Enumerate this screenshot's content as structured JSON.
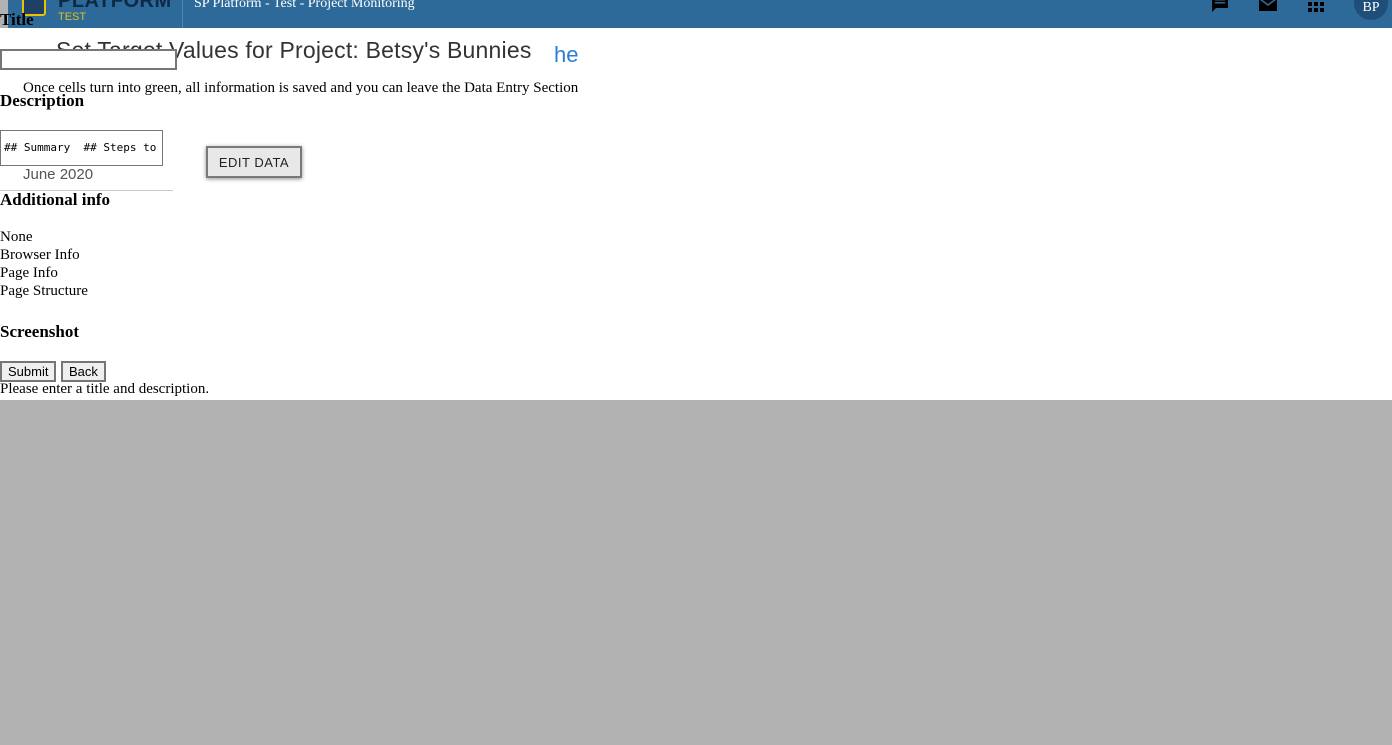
{
  "app": {
    "brand": "PLATFORM",
    "brand_sub": "TEST",
    "window_title": "SP Platform - Test - Project Monitoring",
    "avatar_initials": "BP"
  },
  "page": {
    "heading": "Set Target Values for Project: Betsy's Bunnies",
    "link_fragment": "he",
    "info_line": "Once cells turn into green, all information is saved and you can leave the Data Entry Section",
    "edit_button": "EDIT DATA",
    "month": "June 2020"
  },
  "feedback_form": {
    "title_label": "Title",
    "title_value": "",
    "description_label": "Description",
    "description_value": "## Summary  ## Steps to Reproduce",
    "additional_info_label": "Additional info",
    "options": [
      "None",
      "Browser Info",
      "Page Info",
      "Page Structure"
    ],
    "screenshot_label": "Screenshot",
    "submit_label": "Submit",
    "back_label": "Back",
    "message": "Please enter a title and description."
  },
  "colors": {
    "topbar": "#2d6a99",
    "link": "#2a7fd0",
    "backdrop": "#b1b1b1"
  }
}
